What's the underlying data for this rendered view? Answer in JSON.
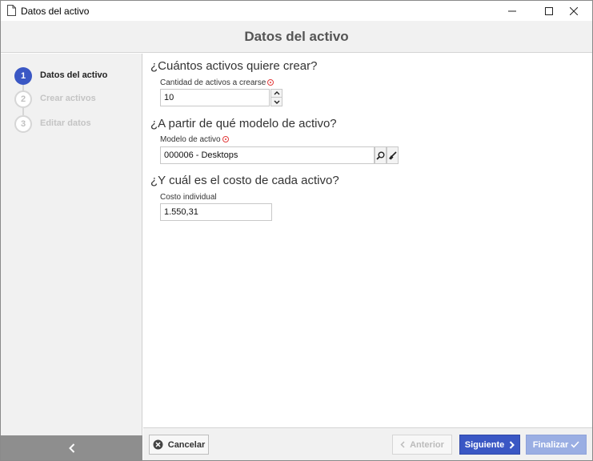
{
  "window": {
    "title": "Datos del activo",
    "controls": {
      "minimize": "minimize",
      "maximize": "maximize",
      "close": "close"
    }
  },
  "header": {
    "title": "Datos del activo"
  },
  "sidebar": {
    "steps": [
      {
        "number": "1",
        "label": "Datos del activo",
        "state": "active"
      },
      {
        "number": "2",
        "label": "Crear activos",
        "state": "inactive"
      },
      {
        "number": "3",
        "label": "Editar datos",
        "state": "inactive"
      }
    ],
    "back_icon": "chevron-left-icon"
  },
  "form": {
    "q1": "¿Cuántos activos quiere crear?",
    "quantity_label": "Cantidad de activos a crearse",
    "quantity_value": "10",
    "q2": "¿A partir de qué modelo de activo?",
    "model_label": "Modelo de activo",
    "model_value": "000006 - Desktops",
    "q3": "¿Y cuál es el costo de cada activo?",
    "cost_label": "Costo individual",
    "cost_value": "1.550,31"
  },
  "footer": {
    "cancel": "Cancelar",
    "previous": "Anterior",
    "next": "Siguiente",
    "finish": "Finalizar"
  },
  "colors": {
    "accent": "#3a57c4",
    "accent_disabled": "#9aaee3",
    "required": "#e23c3c",
    "sidebar_bg": "#f1f1f1"
  }
}
